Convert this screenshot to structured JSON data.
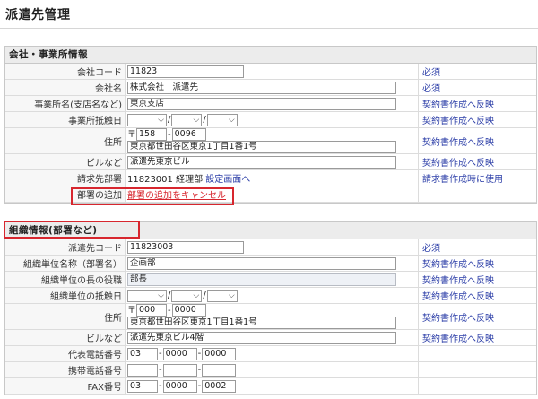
{
  "page": {
    "title": "派遣先管理"
  },
  "company_section": {
    "title": "会社・事業所情報",
    "rows": {
      "company_code": {
        "label": "会社コード",
        "value": "11823",
        "note": "必須"
      },
      "company_name": {
        "label": "会社名",
        "value": "株式会社　派遣先",
        "note": "必須"
      },
      "office_name": {
        "label": "事業所名(支店名など)",
        "value": "東京支店",
        "note": "契約書作成へ反映"
      },
      "office_conflict_date": {
        "label": "事業所抵触日",
        "sep": "/",
        "note": "契約書作成へ反映"
      },
      "address": {
        "label": "住所",
        "postal_mark": "〒",
        "postal1": "158",
        "postal2": "0096",
        "line": "東京都世田谷区東京1丁目1番1号",
        "note": "契約書作成へ反映"
      },
      "building": {
        "label": "ビルなど",
        "value": "派遣先東京ビル",
        "note": "契約書作成へ反映"
      },
      "billing_dept": {
        "label": "請求先部署",
        "value": "11823001 経理部",
        "link": "設定画面へ",
        "note": "請求書作成時に使用"
      },
      "add_dept": {
        "label": "部署の追加",
        "link": "部署の追加をキャンセル"
      }
    }
  },
  "org_section": {
    "title": "組織情報(部署など)",
    "rows": {
      "dest_code": {
        "label": "派遣先コード",
        "value": "11823003",
        "note": "必須"
      },
      "unit_name": {
        "label": "組織単位名称（部署名）",
        "value": "企画部",
        "note": "契約書作成へ反映"
      },
      "head_title": {
        "label": "組織単位の長の役職",
        "value": "部長",
        "note": "契約書作成へ反映"
      },
      "unit_conflict_date": {
        "label": "組織単位の抵触日",
        "sep": "/",
        "note": "契約書作成へ反映"
      },
      "address": {
        "label": "住所",
        "postal_mark": "〒",
        "postal1": "000",
        "postal2": "0000",
        "line": "東京都世田谷区東京1丁目1番1号",
        "note": "契約書作成へ反映"
      },
      "building": {
        "label": "ビルなど",
        "value": "派遣先東京ビル4階",
        "note": "契約書作成へ反映"
      },
      "main_phone": {
        "label": "代表電話番号",
        "p1": "03",
        "p2": "0000",
        "p3": "0000",
        "note": ""
      },
      "mobile": {
        "label": "携帯電話番号",
        "p1": "",
        "p2": "",
        "p3": "",
        "note": ""
      },
      "fax": {
        "label": "FAX番号",
        "p1": "03",
        "p2": "0000",
        "p3": "0002",
        "note": ""
      }
    }
  },
  "colors": {
    "accent_link": "#2d3fa8",
    "highlight_red": "#d7262e",
    "label_bg": "#f7f7f7",
    "header_bg": "#ececec"
  },
  "icons": {
    "dropdown": "chevron-down-icon"
  }
}
